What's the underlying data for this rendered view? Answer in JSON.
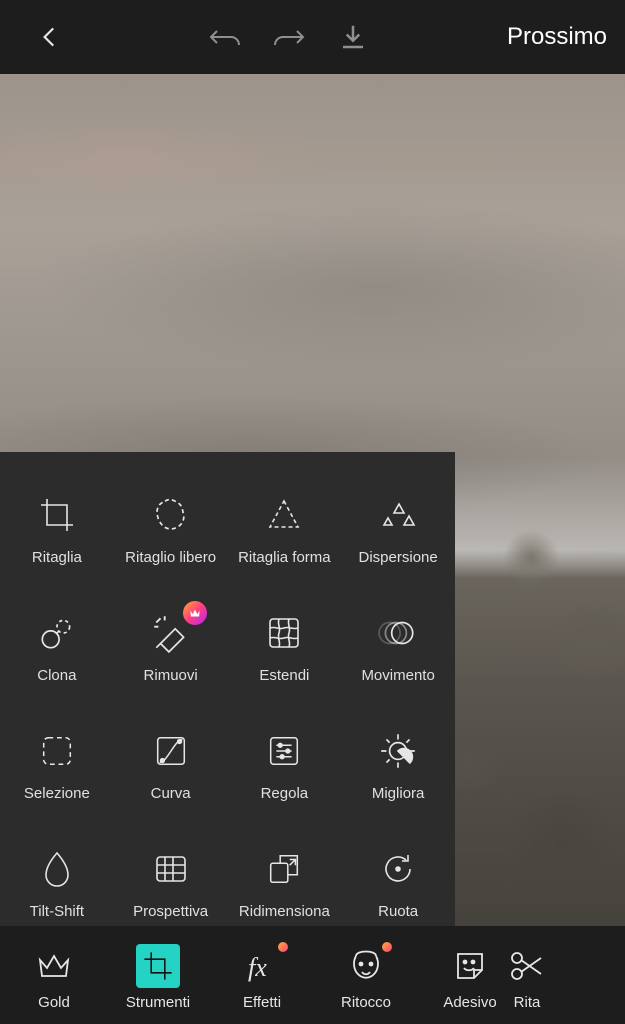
{
  "topbar": {
    "next_label": "Prossimo"
  },
  "tools_panel": {
    "items": [
      {
        "label": "Ritaglia"
      },
      {
        "label": "Ritaglio libero"
      },
      {
        "label": "Ritaglia forma"
      },
      {
        "label": "Dispersione"
      },
      {
        "label": "Clona"
      },
      {
        "label": "Rimuovi",
        "premium": true
      },
      {
        "label": "Estendi"
      },
      {
        "label": "Movimento"
      },
      {
        "label": "Selezione"
      },
      {
        "label": "Curva"
      },
      {
        "label": "Regola"
      },
      {
        "label": "Migliora"
      },
      {
        "label": "Tilt-Shift"
      },
      {
        "label": "Prospettiva"
      },
      {
        "label": "Ridimensiona"
      },
      {
        "label": "Ruota"
      }
    ]
  },
  "bottom_nav": {
    "items": [
      {
        "label": "Gold"
      },
      {
        "label": "Strumenti",
        "active": true
      },
      {
        "label": "Effetti",
        "dot": true
      },
      {
        "label": "Ritocco",
        "dot": true
      },
      {
        "label": "Adesivo"
      },
      {
        "label": "Rita"
      }
    ]
  }
}
